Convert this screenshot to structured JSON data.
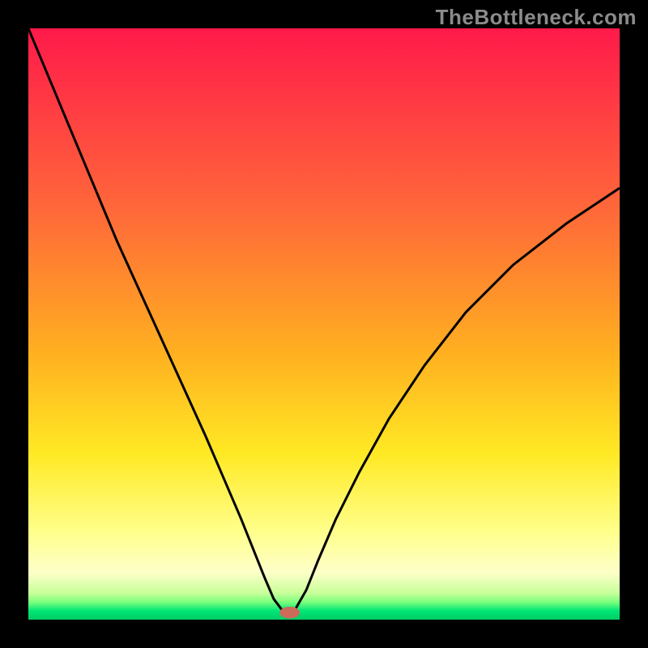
{
  "watermark_text": "TheBottleneck.com",
  "chart_data": {
    "type": "line",
    "title": "",
    "xlabel": "",
    "ylabel": "",
    "xlim": [
      0,
      100
    ],
    "ylim": [
      0,
      100
    ],
    "background_gradient_stops": [
      {
        "offset": 0,
        "color": "#ff1a4a"
      },
      {
        "offset": 0.3,
        "color": "#ff663a"
      },
      {
        "offset": 0.55,
        "color": "#ffb020"
      },
      {
        "offset": 0.72,
        "color": "#ffe924"
      },
      {
        "offset": 0.85,
        "color": "#ffff8a"
      },
      {
        "offset": 0.92,
        "color": "#fdffc8"
      },
      {
        "offset": 0.955,
        "color": "#c8ff9a"
      },
      {
        "offset": 0.97,
        "color": "#7dff7d"
      },
      {
        "offset": 0.985,
        "color": "#00e676"
      },
      {
        "offset": 1.0,
        "color": "#00cc66"
      }
    ],
    "series": [
      {
        "name": "bottleneck-curve",
        "x": [
          0,
          5,
          10,
          15,
          20,
          25,
          30,
          33,
          36,
          38,
          40,
          41.5,
          43,
          44,
          45,
          47,
          49,
          52,
          56,
          61,
          67,
          74,
          82,
          91,
          100
        ],
        "y": [
          100,
          88,
          76,
          64,
          53,
          42,
          31,
          24,
          17,
          12,
          7,
          3.5,
          1.5,
          1.0,
          1.5,
          5,
          10,
          17,
          25,
          34,
          43,
          52,
          60,
          67,
          73
        ]
      }
    ],
    "marker": {
      "x": 44.2,
      "y": 1.2,
      "rx": 1.7,
      "ry": 1.0,
      "color": "#cc6b5a"
    },
    "curve_stroke_width": 3,
    "curve_stroke_color": "#000000"
  }
}
